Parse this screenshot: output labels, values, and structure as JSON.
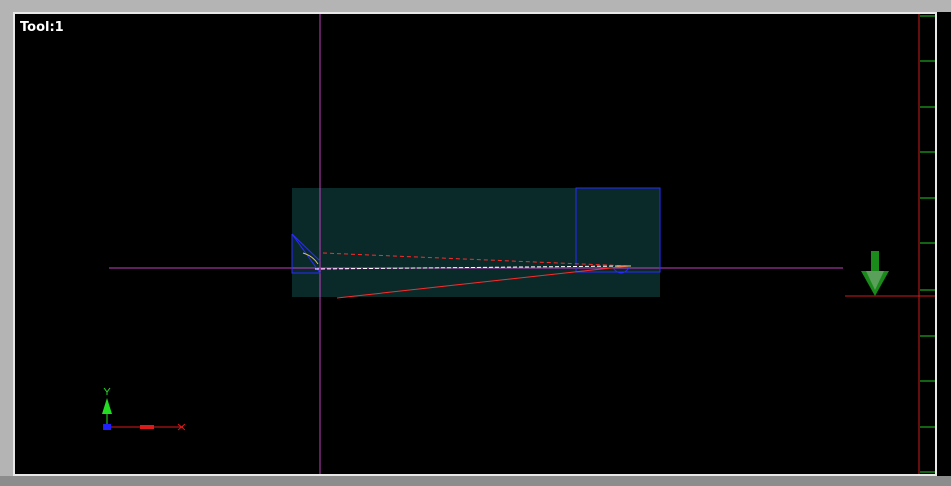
{
  "viewport": {
    "tool_label": "Tool:1",
    "background_color": "#000000"
  },
  "colors": {
    "workpiece_fill": "#0a2a2a",
    "tool_outline": "#2b2bff",
    "center_line": "#c040c0",
    "cut_path": "#ff2a2a",
    "rapid_path": "#ffffff",
    "ruler_line": "#cc1a1a",
    "ruler_ticks": "#22c822",
    "direction_arrow": "#1a8a1a",
    "axis_y": "#22dd22",
    "axis_x": "#dd1a1a",
    "axis_origin": "#2020ff"
  },
  "icons": {
    "axis_gizmo": "xy-axis-icon",
    "down_arrow": "feed-direction-arrow-icon"
  },
  "axis_gizmo": {
    "x_label": "X",
    "y_label": "Y"
  }
}
